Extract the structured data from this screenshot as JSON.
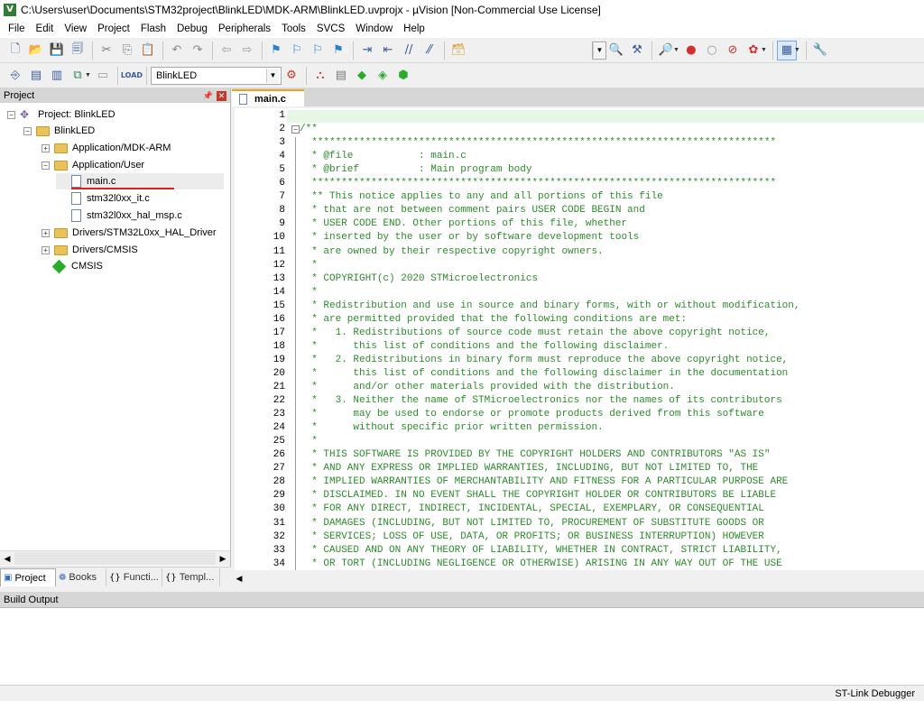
{
  "window": {
    "title": "C:\\Users\\user\\Documents\\STM32project\\BlinkLED\\MDK-ARM\\BlinkLED.uvprojx - µVision  [Non-Commercial Use License]"
  },
  "menu": [
    "File",
    "Edit",
    "View",
    "Project",
    "Flash",
    "Debug",
    "Peripherals",
    "Tools",
    "SVCS",
    "Window",
    "Help"
  ],
  "toolbar2": {
    "target": "BlinkLED"
  },
  "project_panel": {
    "title": "Project",
    "tree": [
      {
        "label": "Project: BlinkLED"
      },
      {
        "label": "BlinkLED"
      },
      {
        "label": "Application/MDK-ARM"
      },
      {
        "label": "Application/User"
      },
      {
        "label": "main.c"
      },
      {
        "label": "stm32l0xx_it.c"
      },
      {
        "label": "stm32l0xx_hal_msp.c"
      },
      {
        "label": "Drivers/STM32L0xx_HAL_Driver"
      },
      {
        "label": "Drivers/CMSIS"
      },
      {
        "label": "CMSIS"
      }
    ],
    "tabs": [
      {
        "label": "Project"
      },
      {
        "label": "Books"
      },
      {
        "label": "Functi..."
      },
      {
        "label": "Templ..."
      }
    ]
  },
  "editor": {
    "tab": "main.c",
    "lines": [
      "",
      "/**",
      "  ******************************************************************************",
      "  * @file           : main.c",
      "  * @brief          : Main program body",
      "  ******************************************************************************",
      "  ** This notice applies to any and all portions of this file",
      "  * that are not between comment pairs USER CODE BEGIN and",
      "  * USER CODE END. Other portions of this file, whether",
      "  * inserted by the user or by software development tools",
      "  * are owned by their respective copyright owners.",
      "  *",
      "  * COPYRIGHT(c) 2020 STMicroelectronics",
      "  *",
      "  * Redistribution and use in source and binary forms, with or without modification,",
      "  * are permitted provided that the following conditions are met:",
      "  *   1. Redistributions of source code must retain the above copyright notice,",
      "  *      this list of conditions and the following disclaimer.",
      "  *   2. Redistributions in binary form must reproduce the above copyright notice,",
      "  *      this list of conditions and the following disclaimer in the documentation",
      "  *      and/or other materials provided with the distribution.",
      "  *   3. Neither the name of STMicroelectronics nor the names of its contributors",
      "  *      may be used to endorse or promote products derived from this software",
      "  *      without specific prior written permission.",
      "  *",
      "  * THIS SOFTWARE IS PROVIDED BY THE COPYRIGHT HOLDERS AND CONTRIBUTORS \"AS IS\"",
      "  * AND ANY EXPRESS OR IMPLIED WARRANTIES, INCLUDING, BUT NOT LIMITED TO, THE",
      "  * IMPLIED WARRANTIES OF MERCHANTABILITY AND FITNESS FOR A PARTICULAR PURPOSE ARE",
      "  * DISCLAIMED. IN NO EVENT SHALL THE COPYRIGHT HOLDER OR CONTRIBUTORS BE LIABLE",
      "  * FOR ANY DIRECT, INDIRECT, INCIDENTAL, SPECIAL, EXEMPLARY, OR CONSEQUENTIAL",
      "  * DAMAGES (INCLUDING, BUT NOT LIMITED TO, PROCUREMENT OF SUBSTITUTE GOODS OR",
      "  * SERVICES; LOSS OF USE, DATA, OR PROFITS; OR BUSINESS INTERRUPTION) HOWEVER",
      "  * CAUSED AND ON ANY THEORY OF LIABILITY, WHETHER IN CONTRACT, STRICT LIABILITY,",
      "  * OR TORT (INCLUDING NEGLIGENCE OR OTHERWISE) ARISING IN ANY WAY OUT OF THE USE"
    ]
  },
  "build_output": {
    "title": "Build Output"
  },
  "status": {
    "debugger": "ST-Link Debugger"
  },
  "colors": {
    "comment": "#2d8a2d",
    "current_line": "#e6f7e6",
    "annotation": "#e02020"
  }
}
